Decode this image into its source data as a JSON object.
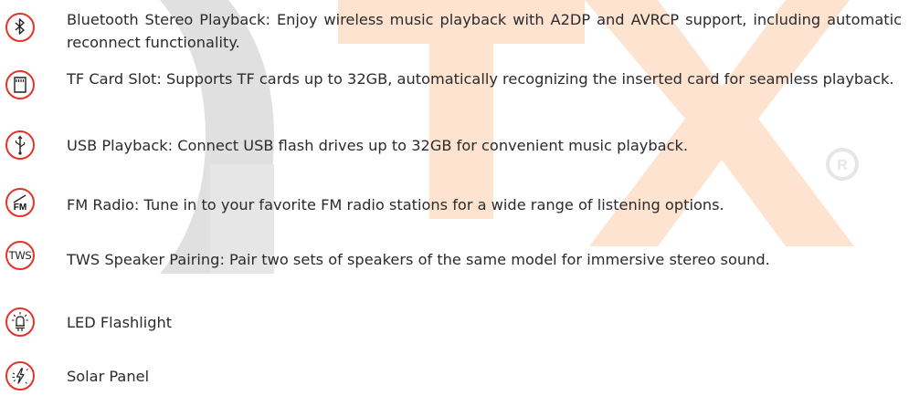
{
  "features": [
    {
      "icon": "bluetooth-icon",
      "text": "Bluetooth Stereo Playback: Enjoy wireless music playback with A2DP and AVRCP support, including automatic reconnect functionality."
    },
    {
      "icon": "tf-card-icon",
      "text": "TF Card Slot: Supports TF cards up to 32GB, automatically recognizing the inserted card for seamless playback."
    },
    {
      "icon": "usb-icon",
      "text": "USB Playback: Connect USB flash drives up to 32GB for convenient music playback."
    },
    {
      "icon": "fm-radio-icon",
      "text": "FM Radio: Tune in to your favorite FM radio stations for a wide range of listening options."
    },
    {
      "icon": "tws-icon",
      "icon_label": "TWS",
      "text": "TWS Speaker Pairing: Pair two sets of speakers of the same model for immersive stereo sound."
    },
    {
      "icon": "led-flashlight-icon",
      "text": "LED Flashlight"
    },
    {
      "icon": "solar-panel-icon",
      "text": "Solar Panel"
    }
  ],
  "colors": {
    "accent": "#e63228",
    "watermark_gray": "#dadada",
    "watermark_orange": "#fde0cc"
  }
}
